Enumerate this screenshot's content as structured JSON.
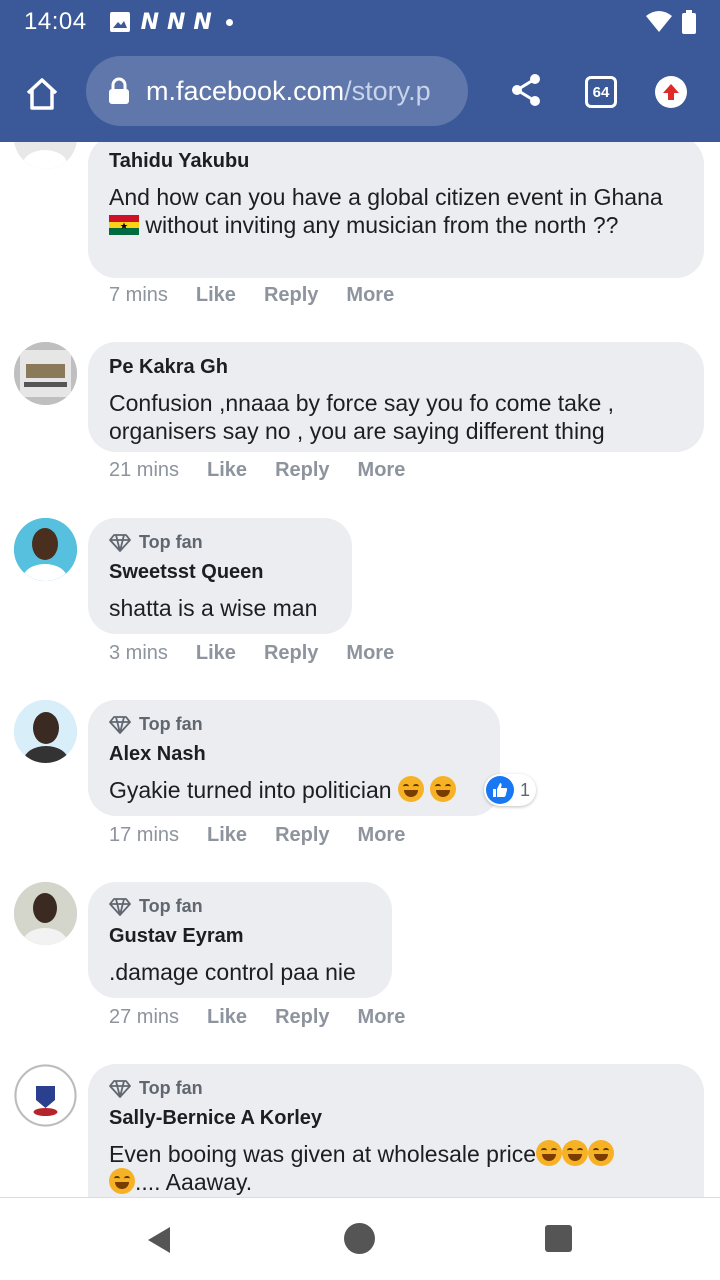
{
  "status_bar": {
    "time": "14:04",
    "notifications": [
      "N",
      "N",
      "N"
    ],
    "icons": [
      "image-icon",
      "wifi-icon",
      "battery-icon"
    ]
  },
  "browser": {
    "url_domain": "m.facebook.com",
    "url_path": "/story.p",
    "tab_count": "64",
    "colors": {
      "bar": "#3b5998",
      "url_box": "#5f77ab",
      "update": "#e02a2a"
    }
  },
  "comments": [
    {
      "author": "Tahidu Yakubu",
      "top_fan": false,
      "text_before_flag": "And how can you have a global citizen event in Ghana ",
      "text_after_flag": " without inviting any musician from the north ??",
      "time": "7 mins",
      "like": "Like",
      "reply": "Reply",
      "more": "More"
    },
    {
      "author": "Pe Kakra Gh",
      "top_fan": false,
      "text": "Confusion ,nnaaa by force say you fo come take , organisers say no , you are saying different thing",
      "time": "21 mins",
      "like": "Like",
      "reply": "Reply",
      "more": "More"
    },
    {
      "badge": "Top fan",
      "author": "Sweetsst Queen",
      "text": "shatta is a wise man",
      "time": "3 mins",
      "like": "Like",
      "reply": "Reply",
      "more": "More"
    },
    {
      "badge": "Top fan",
      "author": "Alex Nash",
      "text": "Gyakie turned into politician ",
      "reaction_count": "1",
      "time": "17 mins",
      "like": "Like",
      "reply": "Reply",
      "more": "More"
    },
    {
      "badge": "Top fan",
      "author": "Gustav Eyram",
      "text": ".damage control paa nie",
      "time": "27 mins",
      "like": "Like",
      "reply": "Reply",
      "more": "More"
    },
    {
      "badge": "Top fan",
      "author": "Sally-Bernice A Korley",
      "text": "Even booing was given at wholesale price",
      "text_tail": ".... Aaaway."
    }
  ]
}
